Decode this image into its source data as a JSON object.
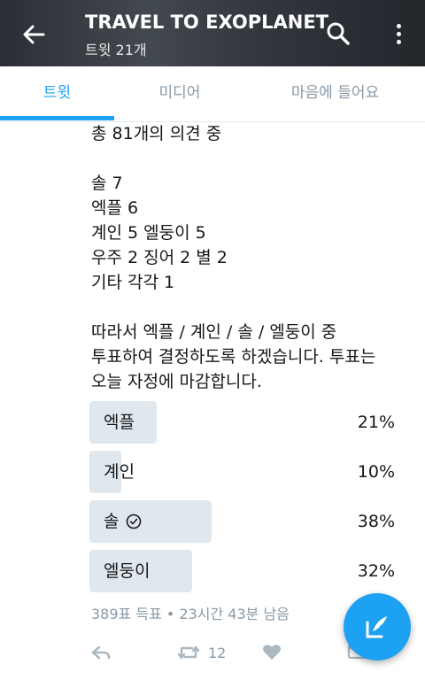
{
  "header": {
    "title": "TRAVEL TO EXOPLANET",
    "subtitle": "트윗 21개"
  },
  "tabs": [
    {
      "label": "트윗",
      "active": true
    },
    {
      "label": "미디어",
      "active": false
    },
    {
      "label": "마음에 들어요",
      "active": false
    }
  ],
  "tweet": {
    "lines_top": [
      "총 81개의 의견 중"
    ],
    "tally": [
      "솔 7",
      "엑플 6",
      "계인 5 엘둥이 5",
      "우주 2 징어 2 별 2",
      "기타 각각 1"
    ],
    "paragraph": [
      "따라서 엑플 / 계인 / 솔 / 엘둥이 중",
      "투표하여 결정하도록 하겠습니다. 투표는",
      "오늘 자정에 마감합니다."
    ]
  },
  "poll": {
    "options": [
      {
        "label": "엑플",
        "percent_text": "21%",
        "value": 21,
        "check": false
      },
      {
        "label": "계인",
        "percent_text": "10%",
        "value": 10,
        "check": false
      },
      {
        "label": "솔",
        "percent_text": "38%",
        "value": 38,
        "check": true
      },
      {
        "label": "엘둥이",
        "percent_text": "32%",
        "value": 32,
        "check": false
      }
    ],
    "meta": "389표 득표 • 23시간 43분 남음"
  },
  "actions": {
    "retweet_count": "12"
  },
  "colors": {
    "accent": "#1da1f2",
    "bar": "#e1e8ed",
    "muted": "#8899a6"
  }
}
